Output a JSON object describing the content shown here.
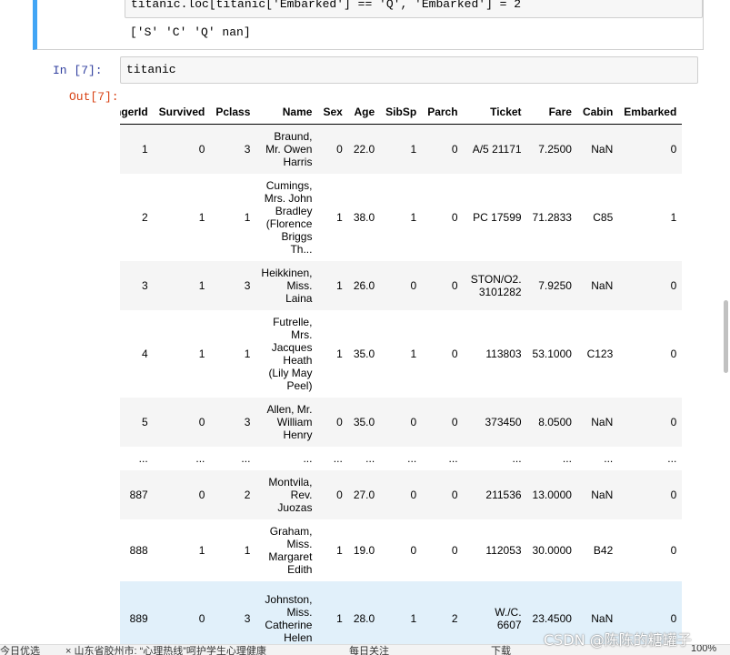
{
  "top_cell": {
    "code": "titanic.loc[titanic['Embarked'] == 'Q', 'Embarked'] = 2",
    "output": "['S' 'C' 'Q' nan]"
  },
  "cell": {
    "in_prompt": "In  [7]:",
    "code": "titanic",
    "out_prompt": "Out[7]:"
  },
  "table": {
    "columns": [
      "ngerId",
      "Survived",
      "Pclass",
      "Name",
      "Sex",
      "Age",
      "SibSp",
      "Parch",
      "Ticket",
      "Fare",
      "Cabin",
      "Embarked"
    ],
    "rows": [
      {
        "cells": [
          "1",
          "0",
          "3",
          "Braund, Mr. Owen Harris",
          "0",
          "22.0",
          "1",
          "0",
          "A/5 21171",
          "7.2500",
          "NaN",
          "0"
        ],
        "hover": false
      },
      {
        "cells": [
          "2",
          "1",
          "1",
          "Cumings, Mrs. John Bradley (Florence Briggs Th...",
          "1",
          "38.0",
          "1",
          "0",
          "PC 17599",
          "71.2833",
          "C85",
          "1"
        ],
        "hover": false
      },
      {
        "cells": [
          "3",
          "1",
          "3",
          "Heikkinen, Miss. Laina",
          "1",
          "26.0",
          "0",
          "0",
          "STON/O2. 3101282",
          "7.9250",
          "NaN",
          "0"
        ],
        "hover": false
      },
      {
        "cells": [
          "4",
          "1",
          "1",
          "Futrelle, Mrs. Jacques Heath (Lily May Peel)",
          "1",
          "35.0",
          "1",
          "0",
          "113803",
          "53.1000",
          "C123",
          "0"
        ],
        "hover": false
      },
      {
        "cells": [
          "5",
          "0",
          "3",
          "Allen, Mr. William Henry",
          "0",
          "35.0",
          "0",
          "0",
          "373450",
          "8.0500",
          "NaN",
          "0"
        ],
        "hover": false
      },
      {
        "cells": [
          "...",
          "...",
          "...",
          "...",
          "...",
          "...",
          "...",
          "...",
          "...",
          "...",
          "...",
          "..."
        ],
        "hover": false
      },
      {
        "cells": [
          "887",
          "0",
          "2",
          "Montvila, Rev. Juozas",
          "0",
          "27.0",
          "0",
          "0",
          "211536",
          "13.0000",
          "NaN",
          "0"
        ],
        "hover": false
      },
      {
        "cells": [
          "888",
          "1",
          "1",
          "Graham, Miss. Margaret Edith",
          "1",
          "19.0",
          "0",
          "0",
          "112053",
          "30.0000",
          "B42",
          "0"
        ],
        "hover": false
      },
      {
        "cells": [
          "889",
          "0",
          "3",
          "Johnston, Miss. Catherine Helen",
          "1",
          "28.0",
          "1",
          "2",
          "W./C. 6607",
          "23.4500",
          "NaN",
          "0"
        ],
        "hover": true
      }
    ]
  },
  "taskbar": {
    "items": [
      "今日优选",
      "× 山东省胶州市: “心理热线”呵护学生心理健康",
      "每日关注",
      "下载",
      "100%"
    ]
  },
  "watermark": "CSDN @陈陈的糖罐子",
  "colors": {
    "accent": "#42a5f5",
    "in_prompt": "#303f9f",
    "out_prompt": "#d84315",
    "hover_row": "#e1f0fa"
  }
}
